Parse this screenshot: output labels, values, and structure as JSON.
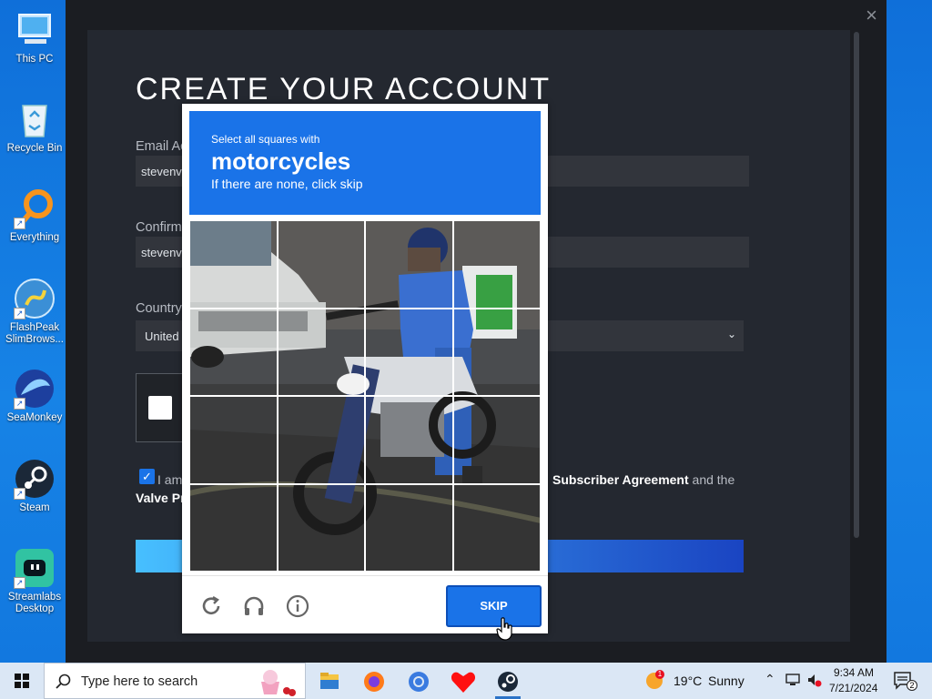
{
  "desktop": {
    "icons": [
      {
        "label": "This PC",
        "icon": "computer-icon"
      },
      {
        "label": "Recycle Bin",
        "icon": "recycle-bin-icon"
      },
      {
        "label": "Everything",
        "icon": "search-magnifier-icon"
      },
      {
        "label": "FlashPeak SlimBrows...",
        "icon": "slimbrowser-icon"
      },
      {
        "label": "SeaMonkey",
        "icon": "seamonkey-icon"
      },
      {
        "label": "Steam",
        "icon": "steam-icon"
      },
      {
        "label": "Streamlabs Desktop",
        "icon": "streamlabs-icon"
      }
    ]
  },
  "steam": {
    "title": "CREATE YOUR ACCOUNT",
    "email_label": "Email Ac",
    "email_value": "stevenv",
    "confirm_label": "Confirm",
    "confirm_value": "stevenv",
    "country_label": "Country",
    "country_value": "United",
    "agree_text": "I am",
    "agree_link": "Subscriber Agreement",
    "agree_suffix": "and the",
    "valve_policy": "Valve Pr",
    "close_icon": "×"
  },
  "captcha": {
    "prompt": "Select all squares with",
    "target": "motorcycles",
    "hint": "If there are none, click skip",
    "skip_label": "SKIP",
    "icons": [
      "refresh-icon",
      "audio-challenge-icon",
      "info-icon"
    ],
    "grid_rows": 4,
    "grid_cols": 4
  },
  "taskbar": {
    "search_placeholder": "Type here to search",
    "apps": [
      "file-explorer-icon",
      "firefox-icon",
      "chrome-icon",
      "undertale-heart-icon",
      "steam-icon"
    ],
    "weather_temp": "19°C",
    "weather_desc": "Sunny",
    "weather_badge": "1",
    "time": "9:34 AM",
    "date": "7/21/2024",
    "notification_count": "2"
  }
}
